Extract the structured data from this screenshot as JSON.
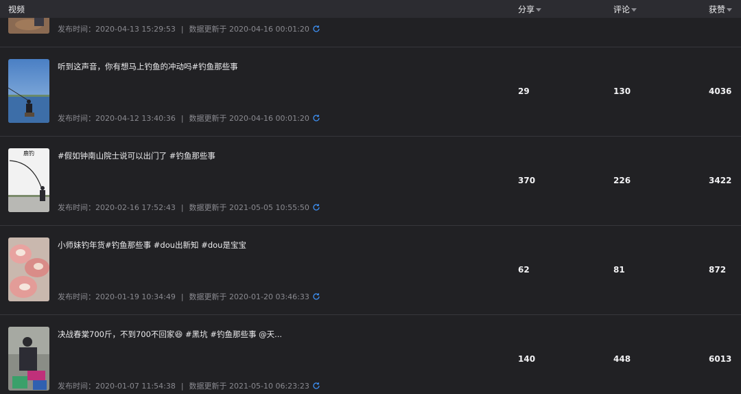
{
  "header": {
    "video_label": "视频",
    "shares_label": "分享",
    "comments_label": "评论",
    "likes_label": "获赞"
  },
  "rows": [
    {
      "title": "",
      "publish": "发布时间：2020-04-13 15:29:53",
      "updated": "数据更新于 2020-04-16 00:01:20",
      "shares": "",
      "comments": "",
      "likes": ""
    },
    {
      "title": "听到这声音，你有想马上钓鱼的冲动吗#钓鱼那些事",
      "publish": "发布时间：2020-04-12 13:40:36",
      "updated": "数据更新于 2020-04-16 00:01:20",
      "shares": "29",
      "comments": "130",
      "likes": "4036"
    },
    {
      "title": "#假如钟南山院士说可以出门了 #钓鱼那些事",
      "publish": "发布时间：2020-02-16 17:52:43",
      "updated": "数据更新于 2021-05-05 10:55:50",
      "shares": "370",
      "comments": "226",
      "likes": "3422",
      "thumb_caption": "鹿钓"
    },
    {
      "title": "小师妹钓年货#钓鱼那些事 #dou出新知 #dou是宝宝",
      "publish": "发布时间：2020-01-19 10:34:49",
      "updated": "数据更新于 2020-01-20 03:46:33",
      "shares": "62",
      "comments": "81",
      "likes": "872"
    },
    {
      "title": "决战春棠700斤，不到700不回家😆 #黑坑 #钓鱼那些事 @天...",
      "publish": "发布时间：2020-01-07 11:54:38",
      "updated": "数据更新于 2021-05-10 06:23:23",
      "shares": "140",
      "comments": "448",
      "likes": "6013"
    }
  ],
  "separator": "|",
  "colors": {
    "background": "#212124",
    "header": "#2c2c31",
    "refresh_icon": "#3d8ef0",
    "meta_text": "#8a8a90"
  }
}
